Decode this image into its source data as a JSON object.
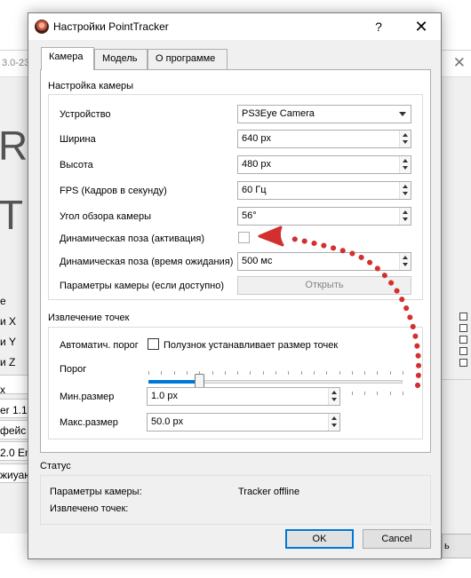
{
  "background_window": {
    "title_fragment": "3.0-23-",
    "big_letters": [
      "RA",
      "T"
    ],
    "labels": [
      "e",
      "и X",
      "и Y",
      "и Z",
      "x",
      "er 1.1",
      "фейс",
      "2.0 Enh",
      "жиуаю"
    ],
    "button_fragment": "ь"
  },
  "dialog": {
    "title": "Настройки PointTracker",
    "help_glyph": "?",
    "close_glyph": "✕",
    "tabs": [
      {
        "label": "Камера",
        "active": true
      },
      {
        "label": "Модель",
        "active": false
      },
      {
        "label": "О программе",
        "active": false
      }
    ],
    "camera_group": {
      "title": "Настройка камеры",
      "device_label": "Устройство",
      "device_value": "PS3Eye Camera",
      "width_label": "Ширина",
      "width_value": "640 px",
      "height_label": "Высота",
      "height_value": "480 px",
      "fps_label": "FPS (Кадров в секунду)",
      "fps_value": "60 Гц",
      "fov_label": "Угол обзора камеры",
      "fov_value": "56°",
      "dyn_pose_label": "Динамическая поза (активация)",
      "dyn_pose_checked": false,
      "dyn_timeout_label": "Динамическая поза (время ожидания)",
      "dyn_timeout_value": "500 мс",
      "cam_params_label": "Параметры камеры (если доступно)",
      "open_button": "Открыть"
    },
    "points_group": {
      "title": "Извлечение точек",
      "auto_threshold_label": "Автоматич. порог",
      "slider_sets_size_label": "Полузнок устанавливает размер точек",
      "auto_checked": false,
      "threshold_label": "Порог",
      "threshold_fraction": 0.2,
      "min_size_label": "Мин.размер",
      "min_size_value": "1.0 px",
      "max_size_label": "Макс.размер",
      "max_size_value": "50.0 px"
    },
    "status_group": {
      "title": "Статус",
      "cam_params_label": "Параметры камеры:",
      "cam_params_value": "Tracker offline",
      "points_label": "Извлечено точек:",
      "points_value": ""
    },
    "ok_button": "OK",
    "cancel_button": "Cancel"
  },
  "colors": {
    "accent": "#0078d7",
    "annotation_red": "#d32f2f"
  }
}
